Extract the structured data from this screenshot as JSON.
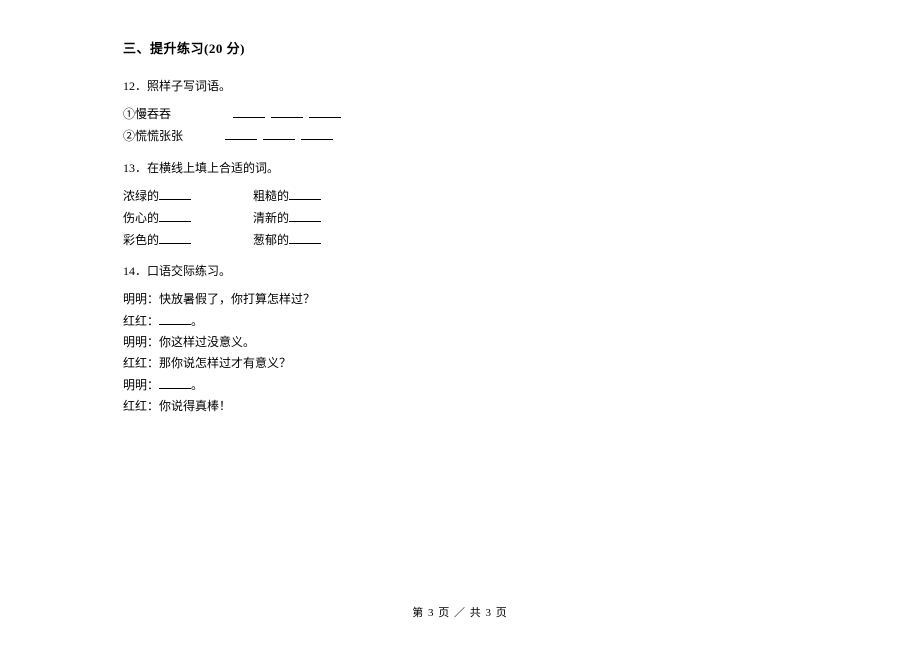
{
  "section": {
    "title": "三、提升练习(20 分)"
  },
  "q12": {
    "number": "12．",
    "prompt": "照样子写词语。",
    "items": [
      "①慢吞吞",
      "②慌慌张张"
    ]
  },
  "q13": {
    "number": "13．",
    "prompt": "在横线上填上合适的词。",
    "rows": [
      {
        "left": "浓绿的",
        "right": "粗糙的"
      },
      {
        "left": "伤心的",
        "right": "清新的"
      },
      {
        "left": "彩色的",
        "right": "葱郁的"
      }
    ]
  },
  "q14": {
    "number": "14．",
    "prompt": "口语交际练习。",
    "dialogue": [
      {
        "text": "明明：快放暑假了，你打算怎样过？",
        "has_blank": false
      },
      {
        "text": "红红：",
        "has_blank": true,
        "suffix": "。"
      },
      {
        "text": "明明：你这样过没意义。",
        "has_blank": false
      },
      {
        "text": "红红：那你说怎样过才有意义？",
        "has_blank": false
      },
      {
        "text": "明明：",
        "has_blank": true,
        "suffix": "。"
      },
      {
        "text": "红红：你说得真棒！",
        "has_blank": false
      }
    ]
  },
  "footer": {
    "text": "第 3 页 ／ 共 3 页"
  }
}
